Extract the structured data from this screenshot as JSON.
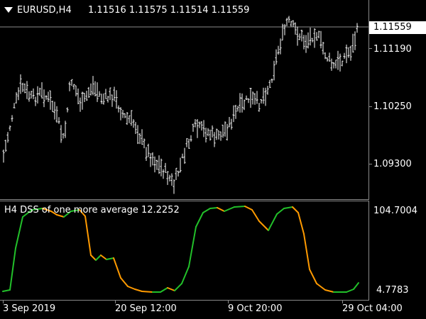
{
  "symbol": {
    "label": "EURUSD,H4",
    "ohlc": "1.11516 1.11575 1.11514 1.11559"
  },
  "price_axis": {
    "current_price": "1.11559",
    "labels": [
      "1.11190",
      "1.10250",
      "1.09300"
    ]
  },
  "indicator": {
    "title": "H4 DSS of one more average 12.2252",
    "labels": [
      "104.7004",
      "4.7783"
    ],
    "up_color": "#22c02a",
    "down_color": "#ff9a00"
  },
  "time_axis": {
    "labels": [
      "3 Sep 2019",
      "20 Sep 12:00",
      "9 Oct 20:00",
      "29 Oct 04:00"
    ]
  },
  "colors": {
    "background": "#000000",
    "bars": "#ffffff",
    "grid": "#8a8a8a"
  }
}
